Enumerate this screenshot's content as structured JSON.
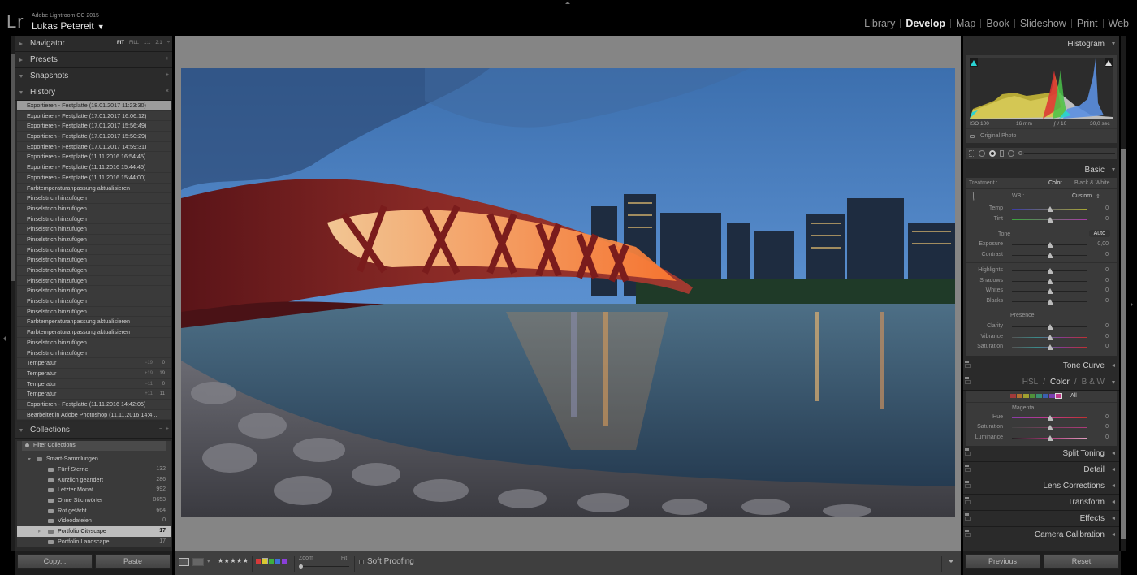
{
  "app": {
    "logo": "Lr",
    "product": "Adobe Lightroom CC 2015",
    "user": "Lukas Petereit",
    "user_caret": "▼"
  },
  "modules": [
    {
      "label": "Library",
      "active": false
    },
    {
      "label": "Develop",
      "active": true
    },
    {
      "label": "Map",
      "active": false
    },
    {
      "label": "Book",
      "active": false
    },
    {
      "label": "Slideshow",
      "active": false
    },
    {
      "label": "Print",
      "active": false
    },
    {
      "label": "Web",
      "active": false
    }
  ],
  "left_panel": {
    "navigator": {
      "title": "Navigator",
      "options": [
        "FIT",
        "FILL",
        "1:1",
        "2:1"
      ],
      "selected": "FIT",
      "more": "÷"
    },
    "presets": {
      "title": "Presets",
      "action": "+"
    },
    "snapshots": {
      "title": "Snapshots",
      "action": "+"
    },
    "history": {
      "title": "History",
      "action": "×",
      "items": [
        {
          "label": "Exportieren - Festplatte (18.01.2017 11:23:30)",
          "selected": true
        },
        {
          "label": "Exportieren - Festplatte (17.01.2017 16:06:12)"
        },
        {
          "label": "Exportieren - Festplatte (17.01.2017 15:56:49)"
        },
        {
          "label": "Exportieren - Festplatte (17.01.2017 15:50:29)"
        },
        {
          "label": "Exportieren - Festplatte (17.01.2017 14:59:31)"
        },
        {
          "label": "Exportieren - Festplatte (11.11.2016 16:54:45)"
        },
        {
          "label": "Exportieren - Festplatte (11.11.2016 15:44:45)"
        },
        {
          "label": "Exportieren - Festplatte (11.11.2016 15:44:00)"
        },
        {
          "label": "Farbtemperaturanpassung aktualisieren"
        },
        {
          "label": "Pinselstrich hinzufügen"
        },
        {
          "label": "Pinselstrich hinzufügen"
        },
        {
          "label": "Pinselstrich hinzufügen"
        },
        {
          "label": "Pinselstrich hinzufügen"
        },
        {
          "label": "Pinselstrich hinzufügen"
        },
        {
          "label": "Pinselstrich hinzufügen"
        },
        {
          "label": "Pinselstrich hinzufügen"
        },
        {
          "label": "Pinselstrich hinzufügen"
        },
        {
          "label": "Pinselstrich hinzufügen"
        },
        {
          "label": "Pinselstrich hinzufügen"
        },
        {
          "label": "Pinselstrich hinzufügen"
        },
        {
          "label": "Pinselstrich hinzufügen"
        },
        {
          "label": "Farbtemperaturanpassung aktualisieren"
        },
        {
          "label": "Farbtemperaturanpassung aktualisieren"
        },
        {
          "label": "Pinselstrich hinzufügen"
        },
        {
          "label": "Pinselstrich hinzufügen"
        },
        {
          "label": "Temperatur",
          "delta": "−19",
          "value": "0"
        },
        {
          "label": "Temperatur",
          "delta": "+19",
          "value": "19"
        },
        {
          "label": "Temperatur",
          "delta": "−11",
          "value": "0"
        },
        {
          "label": "Temperatur",
          "delta": "+11",
          "value": "11"
        },
        {
          "label": "Exportieren - Festplatte (11.11.2016 14:42:05)"
        },
        {
          "label": "Bearbeitet in Adobe Photoshop (11.11.2016 14:4..."
        }
      ]
    },
    "collections": {
      "title": "Collections",
      "actions": [
        "−",
        "+"
      ],
      "filter_label": "Filter Collections",
      "group": "Smart-Sammlungen",
      "items": [
        {
          "label": "Fünf Sterne",
          "count": "132"
        },
        {
          "label": "Kürzlich geändert",
          "count": "286"
        },
        {
          "label": "Letzter Monat",
          "count": "992"
        },
        {
          "label": "Ohne Stichwörter",
          "count": "8653"
        },
        {
          "label": "Rot gefärbt",
          "count": "664"
        },
        {
          "label": "Videodateien",
          "count": "0"
        }
      ],
      "folders": [
        {
          "label": "Portfolio Cityscape",
          "count": "17",
          "selected": true
        },
        {
          "label": "Portfolio Landscape",
          "count": "17",
          "selected": false
        }
      ]
    },
    "copy_label": "Copy...",
    "paste_label": "Paste"
  },
  "toolbar": {
    "rating": "★★★★★",
    "color_labels": [
      "#d63a3a",
      "#d8c830",
      "#3fae3f",
      "#3f6fd8",
      "#8a3fd8"
    ],
    "zoom_label": "Zoom",
    "zoom_fit": "Fit",
    "soft_proofing": "Soft Proofing"
  },
  "right_panel": {
    "histogram": {
      "title": "Histogram",
      "iso": "ISO 100",
      "focal": "16 mm",
      "aperture": "ƒ / 10",
      "shutter": "30,0 sec",
      "original_photo": "Original Photo"
    },
    "basic": {
      "title": "Basic",
      "treatment_label": "Treatment :",
      "treatment_color": "Color",
      "treatment_bw": "Black & White",
      "wb_label": "WB :",
      "wb_value": "Custom",
      "tone_label": "Tone",
      "auto_label": "Auto",
      "presence_label": "Presence",
      "sliders_wb": [
        {
          "label": "Temp",
          "value": "0",
          "position": 0.5
        },
        {
          "label": "Tint",
          "value": "0",
          "position": 0.5
        }
      ],
      "sliders_tone1": [
        {
          "label": "Exposure",
          "value": "0,00",
          "position": 0.5
        },
        {
          "label": "Contrast",
          "value": "0",
          "position": 0.5
        }
      ],
      "sliders_tone2": [
        {
          "label": "Highlights",
          "value": "0",
          "position": 0.5
        },
        {
          "label": "Shadows",
          "value": "0",
          "position": 0.5
        },
        {
          "label": "Whites",
          "value": "0",
          "position": 0.5
        },
        {
          "label": "Blacks",
          "value": "0",
          "position": 0.5
        }
      ],
      "sliders_presence": [
        {
          "label": "Clarity",
          "value": "0",
          "position": 0.5
        },
        {
          "label": "Vibrance",
          "value": "0",
          "position": 0.5
        },
        {
          "label": "Saturation",
          "value": "0",
          "position": 0.5
        }
      ]
    },
    "tone_curve": "Tone Curve",
    "hsl": {
      "tabs": [
        "HSL",
        "Color",
        "B & W"
      ],
      "active_tab": "Color",
      "swatches": [
        "#a03a3a",
        "#b07030",
        "#a0a030",
        "#50903a",
        "#3a9070",
        "#3a60b0",
        "#7a40b0",
        "#c03a8a"
      ],
      "all_label": "All",
      "color_name": "Magenta",
      "sliders": [
        {
          "label": "Hue",
          "value": "0",
          "position": 0.5
        },
        {
          "label": "Saturation",
          "value": "0",
          "position": 0.5
        },
        {
          "label": "Luminance",
          "value": "0",
          "position": 0.5
        }
      ]
    },
    "collapsed_panels": [
      "Split Toning",
      "Detail",
      "Lens Corrections",
      "Transform",
      "Effects",
      "Camera Calibration"
    ],
    "previous_label": "Previous",
    "reset_label": "Reset"
  }
}
